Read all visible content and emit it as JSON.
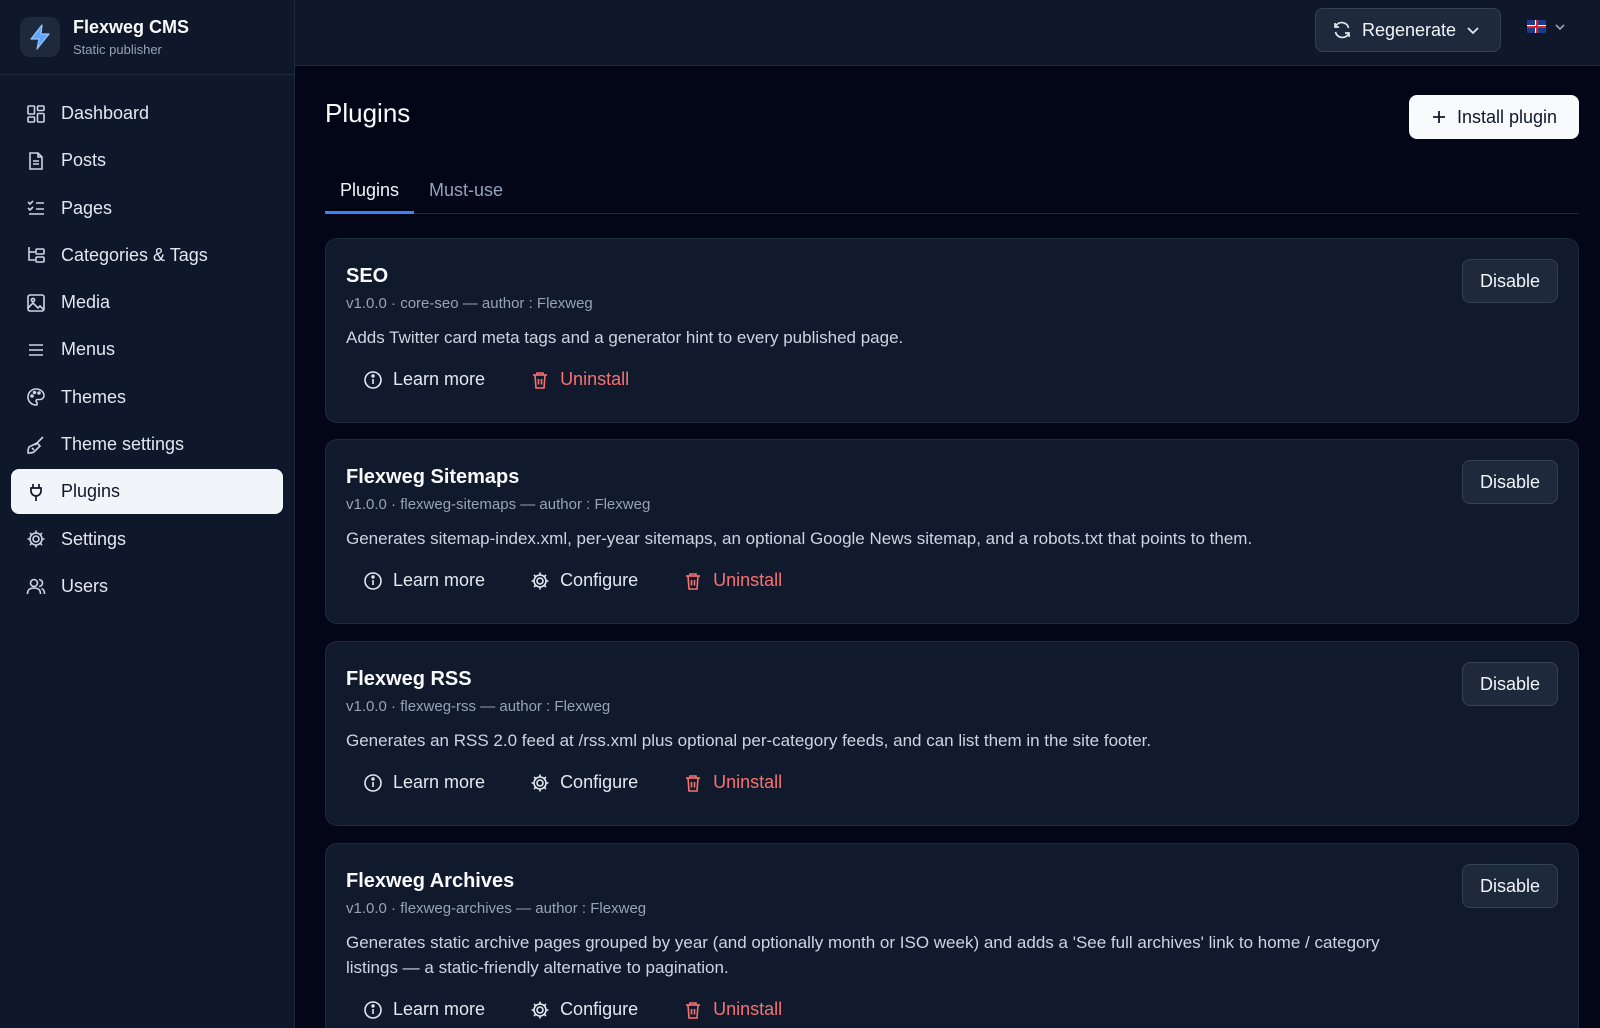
{
  "brand": {
    "name": "Flexweg CMS",
    "subtitle": "Static publisher"
  },
  "sidebar": {
    "items": [
      {
        "label": "Dashboard",
        "icon": "dashboard-icon",
        "active": false
      },
      {
        "label": "Posts",
        "icon": "document-icon",
        "active": false
      },
      {
        "label": "Pages",
        "icon": "list-checks-icon",
        "active": false
      },
      {
        "label": "Categories & Tags",
        "icon": "folder-tree-icon",
        "active": false
      },
      {
        "label": "Media",
        "icon": "image-icon",
        "active": false
      },
      {
        "label": "Menus",
        "icon": "menu-icon",
        "active": false
      },
      {
        "label": "Themes",
        "icon": "palette-icon",
        "active": false
      },
      {
        "label": "Theme settings",
        "icon": "paintbrush-icon",
        "active": false
      },
      {
        "label": "Plugins",
        "icon": "plug-icon",
        "active": true
      },
      {
        "label": "Settings",
        "icon": "gear-icon",
        "active": false
      },
      {
        "label": "Users",
        "icon": "users-icon",
        "active": false
      }
    ]
  },
  "topbar": {
    "regenerate_label": "Regenerate",
    "language": "en-GB"
  },
  "page": {
    "title": "Plugins",
    "install_label": "Install plugin",
    "tabs": [
      {
        "label": "Plugins",
        "active": true
      },
      {
        "label": "Must-use",
        "active": false
      }
    ]
  },
  "plugins": [
    {
      "name": "SEO",
      "meta": "v1.0.0 · core-seo — author : Flexweg",
      "description": "Adds Twitter card meta tags and a generator hint to every published page.",
      "disable_label": "Disable",
      "learn_label": "Learn more",
      "configure_label": "",
      "uninstall_label": "Uninstall"
    },
    {
      "name": "Flexweg Sitemaps",
      "meta": "v1.0.0 · flexweg-sitemaps — author : Flexweg",
      "description": "Generates sitemap-index.xml, per-year sitemaps, an optional Google News sitemap, and a robots.txt that points to them.",
      "disable_label": "Disable",
      "learn_label": "Learn more",
      "configure_label": "Configure",
      "uninstall_label": "Uninstall"
    },
    {
      "name": "Flexweg RSS",
      "meta": "v1.0.0 · flexweg-rss — author : Flexweg",
      "description": "Generates an RSS 2.0 feed at /rss.xml plus optional per-category feeds, and can list them in the site footer.",
      "disable_label": "Disable",
      "learn_label": "Learn more",
      "configure_label": "Configure",
      "uninstall_label": "Uninstall"
    },
    {
      "name": "Flexweg Archives",
      "meta": "v1.0.0 · flexweg-archives — author : Flexweg",
      "description": "Generates static archive pages grouped by year (and optionally month or ISO week) and adds a 'See full archives' link to home / category listings — a static-friendly alternative to pagination.",
      "disable_label": "Disable",
      "learn_label": "Learn more",
      "configure_label": "Configure",
      "uninstall_label": "Uninstall"
    }
  ]
}
